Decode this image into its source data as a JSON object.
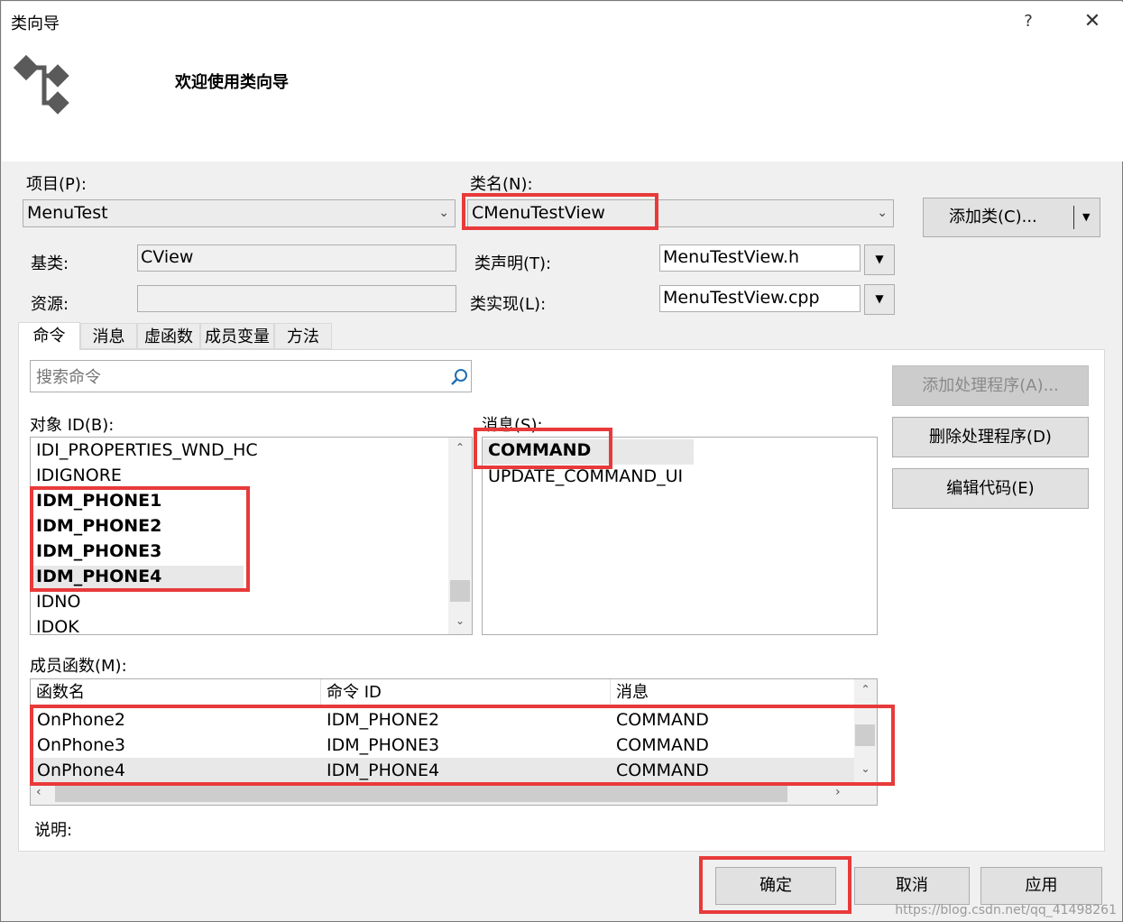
{
  "window": {
    "title": "类向导",
    "help": "?",
    "close": "✕"
  },
  "header": {
    "welcome": "欢迎使用类向导"
  },
  "project": {
    "label": "项目(P):",
    "value": "MenuTest"
  },
  "classname": {
    "label": "类名(N):",
    "value": "CMenuTestView"
  },
  "add_class": {
    "label": "添加类(C)..."
  },
  "base": {
    "label": "基类:",
    "value": "CView"
  },
  "resource": {
    "label": "资源:",
    "value": ""
  },
  "decl": {
    "label": "类声明(T):",
    "value": "MenuTestView.h"
  },
  "impl": {
    "label": "类实现(L):",
    "value": "MenuTestView.cpp"
  },
  "tabs": [
    "命令",
    "消息",
    "虚函数",
    "成员变量",
    "方法"
  ],
  "search": {
    "placeholder": "搜索命令"
  },
  "object_ids": {
    "label": "对象 ID(B):",
    "items": [
      "IDI_PROPERTIES_WND_HC",
      "IDIGNORE",
      "IDM_PHONE1",
      "IDM_PHONE2",
      "IDM_PHONE3",
      "IDM_PHONE4",
      "IDNO",
      "IDOK"
    ]
  },
  "messages": {
    "label": "消息(S):",
    "items": [
      "COMMAND",
      "UPDATE_COMMAND_UI"
    ]
  },
  "actions": {
    "add_handler": "添加处理程序(A)...",
    "delete_handler": "删除处理程序(D)",
    "edit_code": "编辑代码(E)"
  },
  "members": {
    "label": "成员函数(M):",
    "columns": [
      "函数名",
      "命令 ID",
      "消息"
    ],
    "rows": [
      [
        "OnPhone2",
        "IDM_PHONE2",
        "COMMAND"
      ],
      [
        "OnPhone3",
        "IDM_PHONE3",
        "COMMAND"
      ],
      [
        "OnPhone4",
        "IDM_PHONE4",
        "COMMAND"
      ]
    ]
  },
  "description": {
    "label": "说明:"
  },
  "footer": {
    "ok": "确定",
    "cancel": "取消",
    "apply": "应用"
  },
  "watermark": "https://blog.csdn.net/qq_41498261",
  "colors": {
    "highlight": "#e83a3a",
    "selected_row": "#e8e8e8"
  }
}
